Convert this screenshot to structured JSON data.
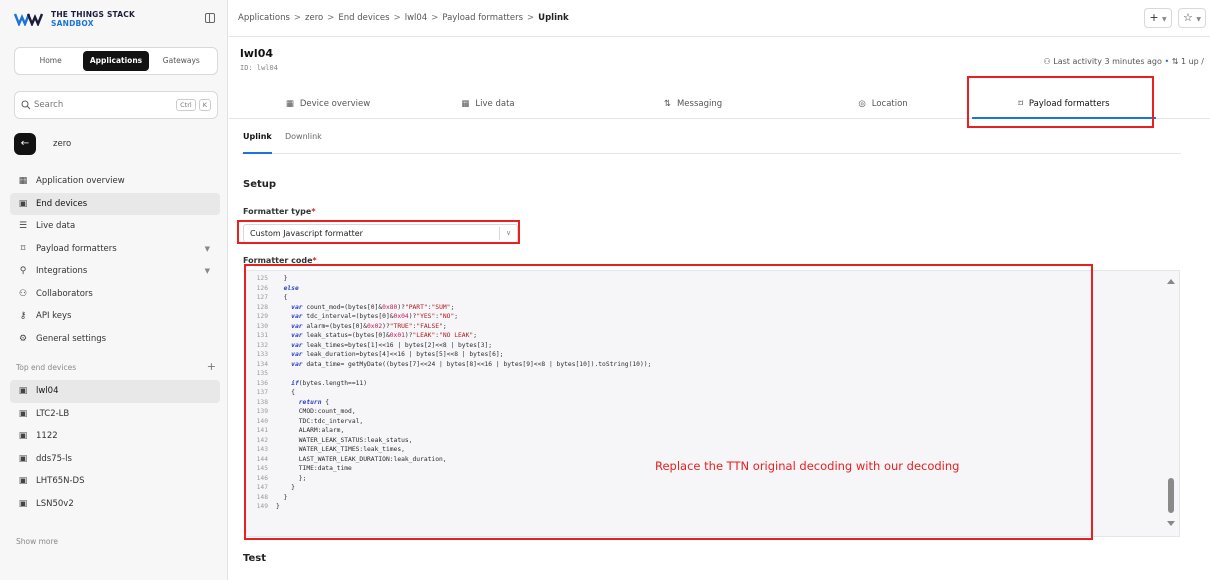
{
  "brand": {
    "line1": "THE THINGS STACK",
    "line2": "SANDBOX"
  },
  "switcher": [
    "Home",
    "Applications",
    "Gateways"
  ],
  "search": {
    "placeholder": "Search",
    "kbd1": "Ctrl",
    "kbd2": "K"
  },
  "app_name": "zero",
  "nav": [
    {
      "label": "Application overview",
      "icon": "grid-icon"
    },
    {
      "label": "End devices",
      "icon": "chip-icon"
    },
    {
      "label": "Live data",
      "icon": "list-icon"
    },
    {
      "label": "Payload formatters",
      "icon": "code-icon"
    },
    {
      "label": "Integrations",
      "icon": "integrations-icon"
    },
    {
      "label": "Collaborators",
      "icon": "users-icon"
    },
    {
      "label": "API keys",
      "icon": "key-icon"
    },
    {
      "label": "General settings",
      "icon": "gear-icon"
    }
  ],
  "top_devices_title": "Top end devices",
  "top_devices": [
    "lwl04",
    "LTC2-LB",
    "1122",
    "dds75-ls",
    "LHT65N-DS",
    "LSN50v2"
  ],
  "show_more": "Show more",
  "breadcrumb": [
    "Applications",
    "zero",
    "End devices",
    "lwl04",
    "Payload formatters",
    "Uplink"
  ],
  "device": {
    "name": "lwl04",
    "id": "ID: lwl04"
  },
  "activity": {
    "text": "Last activity 3 minutes ago",
    "traffic": "1 up /"
  },
  "tabs": [
    "Device overview",
    "Live data",
    "Messaging",
    "Location",
    "Payload formatters"
  ],
  "subtabs": [
    "Uplink",
    "Downlink"
  ],
  "setup_heading": "Setup",
  "formatter_type_label": "Formatter type",
  "formatter_type_value": "Custom Javascript formatter",
  "formatter_code_label": "Formatter code",
  "annotation": "Replace the TTN original decoding with our decoding",
  "test_heading": "Test",
  "code_lines": [
    {
      "n": "125",
      "t": "  }"
    },
    {
      "n": "126",
      "t": "  else"
    },
    {
      "n": "127",
      "t": "  {"
    },
    {
      "n": "128",
      "t": "    var count_mod=(bytes[0]&0x80)?\"PART\":\"SUM\";"
    },
    {
      "n": "129",
      "t": "    var tdc_interval=(bytes[0]&0x04)?\"YES\":\"NO\";"
    },
    {
      "n": "130",
      "t": "    var alarm=(bytes[0]&0x02)?\"TRUE\":\"FALSE\";"
    },
    {
      "n": "131",
      "t": "    var leak_status=(bytes[0]&0x01)?\"LEAK\":\"NO LEAK\";"
    },
    {
      "n": "132",
      "t": "    var leak_times=bytes[1]<<16 | bytes[2]<<8 | bytes[3];"
    },
    {
      "n": "133",
      "t": "    var leak_duration=bytes[4]<<16 | bytes[5]<<8 | bytes[6];"
    },
    {
      "n": "134",
      "t": "    var data_time= getMyDate((bytes[7]<<24 | bytes[8]<<16 | bytes[9]<<8 | bytes[10]).toString(10));"
    },
    {
      "n": "135",
      "t": ""
    },
    {
      "n": "136",
      "t": "    if(bytes.length==11)"
    },
    {
      "n": "137",
      "t": "    {"
    },
    {
      "n": "138",
      "t": "      return {"
    },
    {
      "n": "139",
      "t": "      CMOD:count_mod,"
    },
    {
      "n": "140",
      "t": "      TDC:tdc_interval,"
    },
    {
      "n": "141",
      "t": "      ALARM:alarm,"
    },
    {
      "n": "142",
      "t": "      WATER_LEAK_STATUS:leak_status,"
    },
    {
      "n": "143",
      "t": "      WATER_LEAK_TIMES:leak_times,"
    },
    {
      "n": "144",
      "t": "      LAST_WATER_LEAK_DURATION:leak_duration,"
    },
    {
      "n": "145",
      "t": "      TIME:data_time"
    },
    {
      "n": "146",
      "t": "      };"
    },
    {
      "n": "147",
      "t": "    }"
    },
    {
      "n": "148",
      "t": "  }"
    },
    {
      "n": "149",
      "t": "}"
    }
  ],
  "colors": {
    "accent": "#1b74d8",
    "highlight": "#e8201f",
    "active_bg": "#121212"
  }
}
